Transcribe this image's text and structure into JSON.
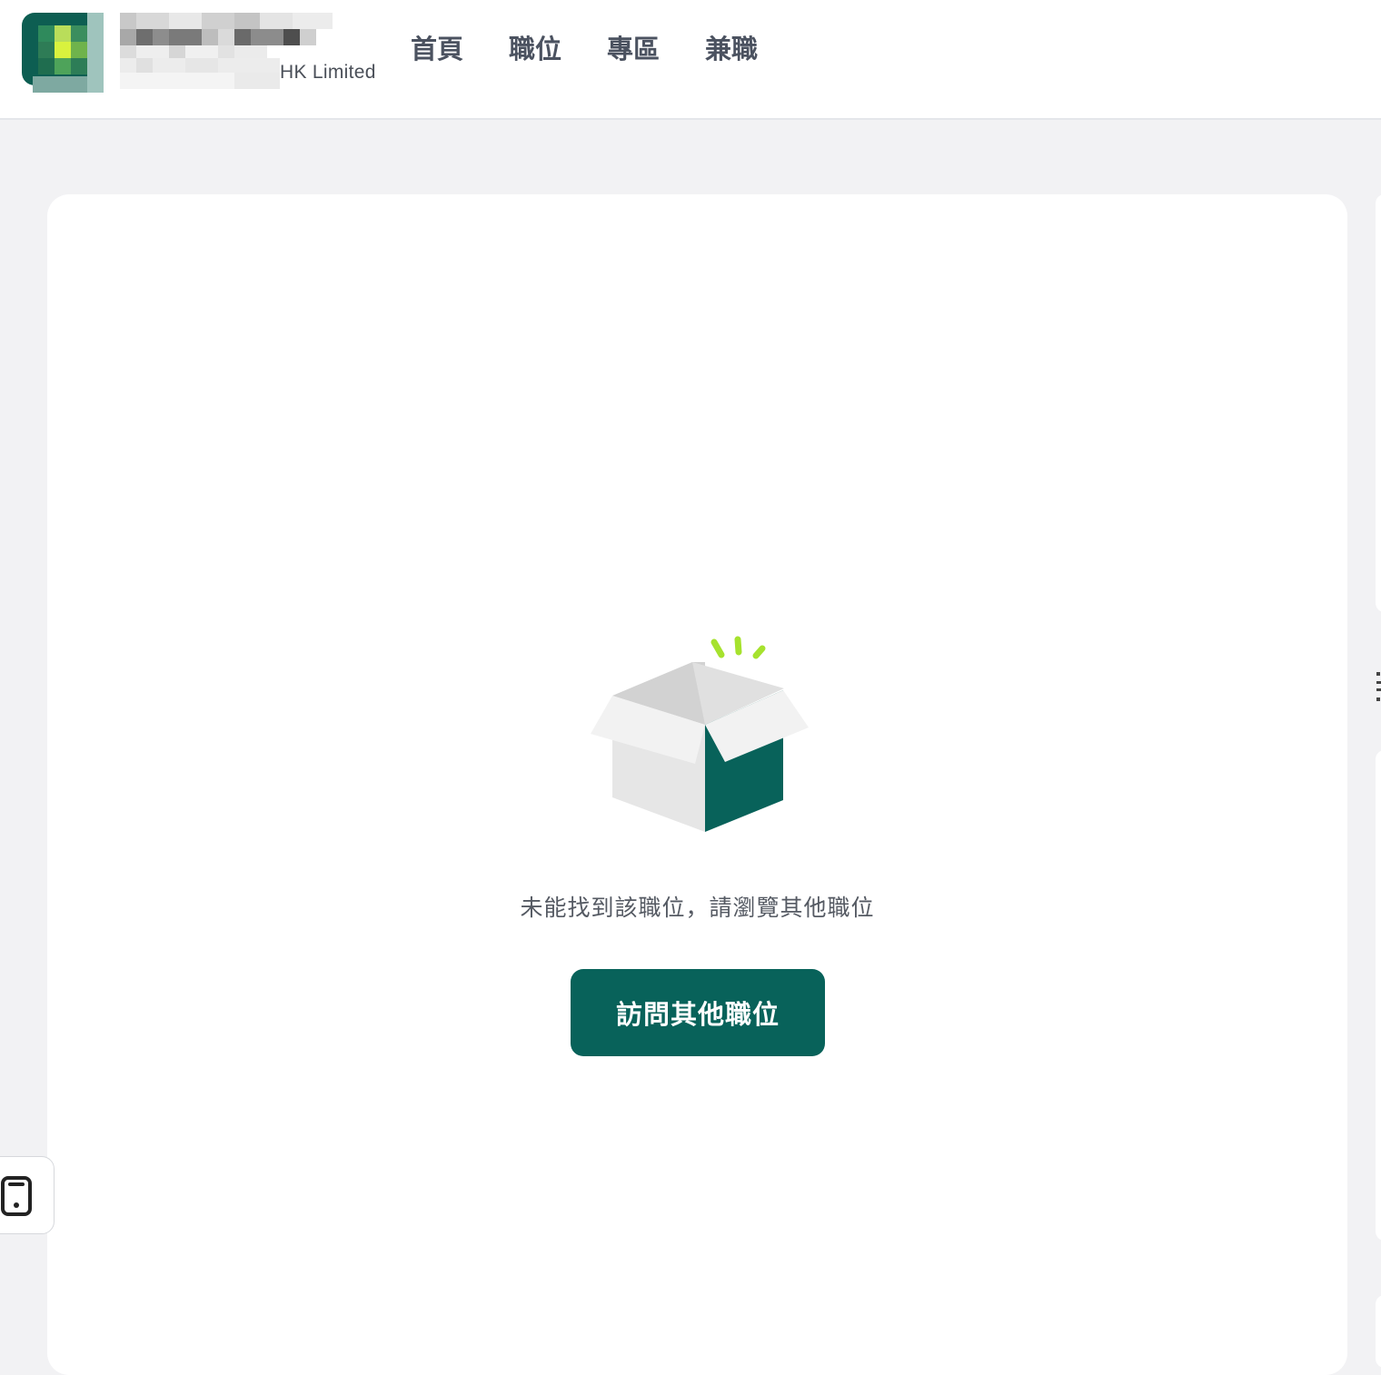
{
  "header": {
    "logo_subtitle": "HK Limited",
    "nav": [
      {
        "label": "首頁"
      },
      {
        "label": "職位"
      },
      {
        "label": "專區"
      },
      {
        "label": "兼職"
      }
    ]
  },
  "main": {
    "illustration_icon": "open-empty-box-icon",
    "empty_message": "未能找到該職位，請瀏覽其他職位",
    "cta_label": "訪問其他職位"
  },
  "side_tab": {
    "icon": "mobile-phone-icon"
  },
  "colors": {
    "brand_green": "#08625a",
    "accent_lime": "#a6e22e",
    "page_background": "#f2f2f4"
  }
}
